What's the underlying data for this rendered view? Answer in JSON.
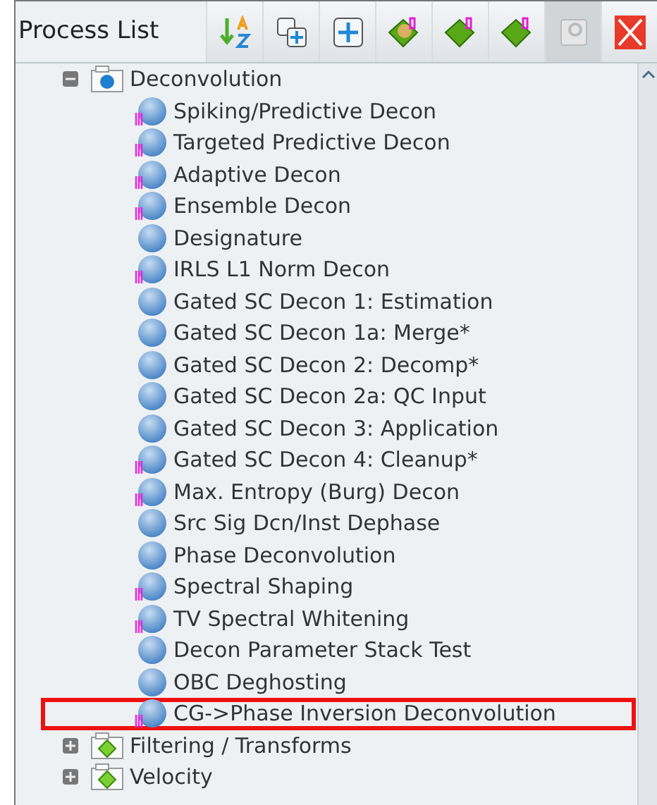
{
  "panel": {
    "title": "Process List"
  },
  "toolbar": [
    {
      "kind": "sort",
      "disabled": false
    },
    {
      "kind": "copy",
      "disabled": false
    },
    {
      "kind": "add",
      "disabled": false
    },
    {
      "kind": "tag-ball",
      "disabled": false
    },
    {
      "kind": "tag",
      "disabled": false
    },
    {
      "kind": "tag",
      "disabled": false
    },
    {
      "kind": "blank",
      "disabled": true
    },
    {
      "kind": "close",
      "disabled": false
    }
  ],
  "tree": [
    {
      "label": "Deconvolution",
      "expanded": true,
      "children": [
        {
          "label": "Spiking/Predictive Decon",
          "marked": true,
          "highlighted": false
        },
        {
          "label": "Targeted Predictive Decon",
          "marked": true,
          "highlighted": false
        },
        {
          "label": "Adaptive Decon",
          "marked": true,
          "highlighted": false
        },
        {
          "label": "Ensemble Decon",
          "marked": true,
          "highlighted": false
        },
        {
          "label": "Designature",
          "marked": false,
          "highlighted": false
        },
        {
          "label": "IRLS L1 Norm Decon",
          "marked": true,
          "highlighted": false
        },
        {
          "label": "Gated SC Decon 1: Estimation",
          "marked": false,
          "highlighted": false
        },
        {
          "label": "Gated SC Decon 1a: Merge*",
          "marked": false,
          "highlighted": false
        },
        {
          "label": "Gated SC Decon 2: Decomp*",
          "marked": false,
          "highlighted": false
        },
        {
          "label": "Gated SC Decon 2a: QC Input",
          "marked": false,
          "highlighted": false
        },
        {
          "label": "Gated SC Decon 3: Application",
          "marked": false,
          "highlighted": false
        },
        {
          "label": "Gated SC Decon 4: Cleanup*",
          "marked": true,
          "highlighted": false
        },
        {
          "label": "Max. Entropy (Burg) Decon",
          "marked": true,
          "highlighted": false
        },
        {
          "label": "Src Sig Dcn/Inst Dephase",
          "marked": false,
          "highlighted": false
        },
        {
          "label": "Phase Deconvolution",
          "marked": false,
          "highlighted": false
        },
        {
          "label": "Spectral Shaping",
          "marked": true,
          "highlighted": false
        },
        {
          "label": "TV Spectral Whitening",
          "marked": true,
          "highlighted": false
        },
        {
          "label": "Decon Parameter Stack Test",
          "marked": false,
          "highlighted": false
        },
        {
          "label": "OBC Deghosting",
          "marked": false,
          "highlighted": false
        },
        {
          "label": "CG->Phase Inversion Deconvolution",
          "marked": true,
          "highlighted": true
        }
      ]
    },
    {
      "label": "Filtering / Transforms",
      "expanded": false
    },
    {
      "label": "Velocity",
      "expanded": false
    }
  ]
}
